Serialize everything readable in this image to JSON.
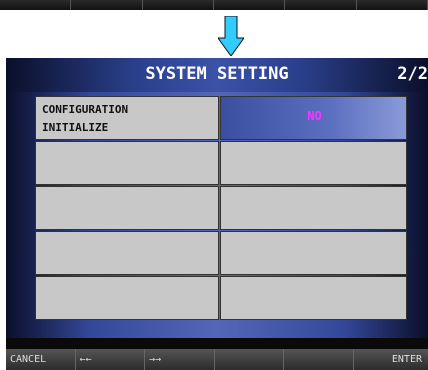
{
  "window": {
    "title": "SYSTEM SETTING",
    "page_indicator": "2/2"
  },
  "settings": {
    "rows": [
      {
        "label": "CONFIGURATION\nINITIALIZE",
        "value": "NO",
        "active": true
      },
      {
        "label": "",
        "value": "",
        "active": false
      },
      {
        "label": "",
        "value": "",
        "active": false
      },
      {
        "label": "",
        "value": "",
        "active": false
      },
      {
        "label": "",
        "value": "",
        "active": false
      }
    ]
  },
  "footer": {
    "cancel": "CANCEL",
    "prev": "←←",
    "next": "→→",
    "blank1": "",
    "blank2": "",
    "enter": "ENTER"
  },
  "colors": {
    "value_text": "#ff33ff",
    "arrow": "#33ccff"
  },
  "icons": {
    "transition": "down-arrow-icon"
  }
}
